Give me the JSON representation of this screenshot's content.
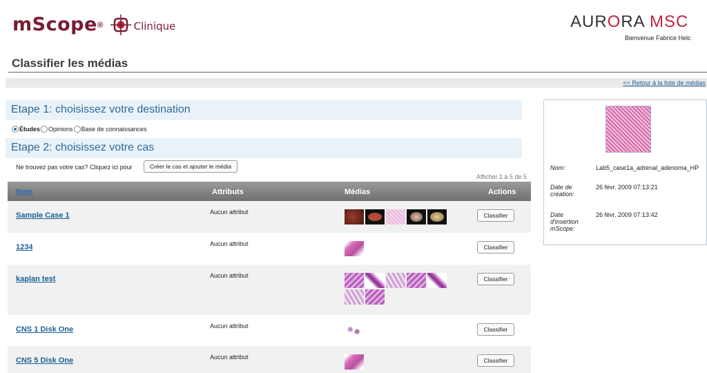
{
  "header": {
    "brand": "mScope",
    "brand_reg": "®",
    "brand_sub": "Clinique",
    "partner_left": "AUR",
    "partner_o": "O",
    "partner_right": "RA ",
    "partner_accent": "MSC",
    "welcome": "Bienvenue Fabrice Helc"
  },
  "page": {
    "title": "Classifier les médias",
    "return_link": "<< Retour à la liste de médias"
  },
  "step1": {
    "title": "Etape 1: choisissez votre destination",
    "options": [
      "Études",
      "Opinions",
      "Base de connaissances"
    ],
    "selected": "Études"
  },
  "step2": {
    "title": "Etape 2: choisissez votre cas",
    "not_found": "Ne trouvez pas votre cas? Cliquez ici pour",
    "create_button": "Créer le cas et ajouter le média",
    "showing": "Afficher 1 à 5 de 5"
  },
  "table": {
    "columns": [
      "Nom",
      "Attributs",
      "Médias",
      "Actions"
    ],
    "rows": [
      {
        "name": "Sample Case 1",
        "attributes": "Aucun attribut",
        "action": "Classifier"
      },
      {
        "name": "1234",
        "attributes": "Aucun attribut",
        "action": "Classifier"
      },
      {
        "name": "kaplan test",
        "attributes": "Aucun attribut",
        "action": "Classifier"
      },
      {
        "name": "CNS 1 Disk One",
        "attributes": "Aucun attribut",
        "action": "Classifier"
      },
      {
        "name": "CNS 5 Disk One",
        "attributes": "Aucun attribut",
        "action": "Classifier"
      }
    ]
  },
  "details": {
    "name_label": "Nom:",
    "name_value": "Lab5_case1a_adrenal_adenoma_HP",
    "created_label": "Date de création:",
    "created_value": "26 févr. 2009 07:13:21",
    "inserted_label": "Date d'insertion mScope:",
    "inserted_value": "26 févr. 2009 07:13:42"
  },
  "colors": {
    "brand": "#7a1a33",
    "accent": "#c3243e",
    "step_title": "#2d6a98",
    "link": "#1b5e96"
  }
}
